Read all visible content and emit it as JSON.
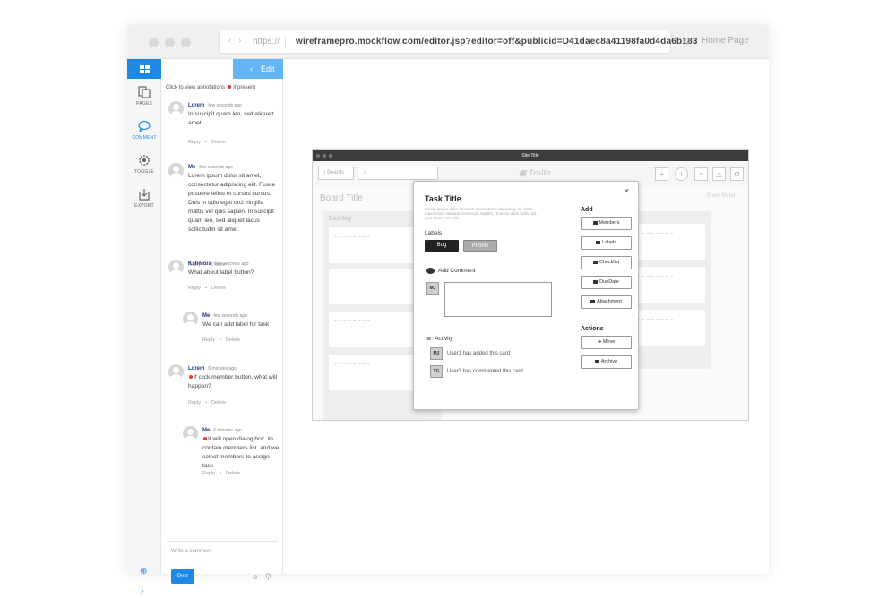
{
  "browser": {
    "protocol": "https://",
    "url": "wireframepro.mockflow.com/editor.jsp?editor=off&publicid=D41daec8a41198fa0d4da6b183",
    "home_label": "Home Page"
  },
  "sidebar": {
    "items": [
      {
        "label": "PAGES",
        "icon": "pages-icon"
      },
      {
        "label": "COMMENT",
        "icon": "comment-icon"
      },
      {
        "label": "TOGGLE",
        "icon": "toggle-icon"
      },
      {
        "label": "EXPORT",
        "icon": "export-icon"
      }
    ],
    "active_color": "#1e88e5"
  },
  "panel": {
    "edit_label": "Edit",
    "annotation_hint_prefix": "Click to view annotations",
    "annotation_hint_suffix": "if present",
    "reply_label": "Reply",
    "delete_label": "Delete",
    "comments": [
      {
        "author": "Lorem",
        "time": "few seconds ago",
        "text": "In suscipit quam leo, sed aliquett amet."
      },
      {
        "author": "Me",
        "time": "few seconds ago",
        "text": "Lorem ipsum dolor sit amet, consectetur adipiscing elit. Fusce posuere tellus et cursus cursus. Duis in odio eget orci fringilla mattis vel quis sapien. In suscipit quam leo, sed aliquet lacus sollicitudin sit amet."
      },
      {
        "author": "Kshmora",
        "time": "few seconds ago",
        "text": "What about label button?"
      },
      {
        "author": "Me",
        "time": "few seconds ago",
        "text": "We can add label for task"
      },
      {
        "author": "Lorem",
        "time": "6 minutes ago",
        "text": "If click member button, what will happen?"
      },
      {
        "author": "Me",
        "time": "6 minutes ago",
        "text": "It will open dialog box. its contain members list. and we select members to assign task"
      }
    ],
    "write_placeholder": "Write a comment",
    "post_label": "Post"
  },
  "mock": {
    "site_title": "Site Title",
    "boards_label": "Boards",
    "logo": "Trello",
    "board_title": "Board Title",
    "show_menu": "Show Menu",
    "list_title": "Backlog",
    "modal": {
      "title": "Task Title",
      "description": "Lorem ipsum dolor sit amet, consectetur adipiscing elit. Nam maecenas, natoque commodo sagittis, rhoncus diam nulla nisl, quis tortor nec erat.",
      "labels_heading": "Labels",
      "labels": [
        "Bug",
        "Priority"
      ],
      "add_comment_heading": "Add Comment",
      "user_initials": "MJ",
      "activity_heading": "Activity",
      "activity": [
        {
          "initials": "MJ",
          "text": "User1 has added this card"
        },
        {
          "initials": "TG",
          "text": "User3 has commented this card"
        }
      ],
      "add_heading": "Add",
      "add_buttons": [
        "Members",
        "Labels",
        "Checklist",
        "DueDate",
        "Attachment"
      ],
      "actions_heading": "Actions",
      "action_buttons": [
        "Move",
        "Archive"
      ]
    }
  }
}
